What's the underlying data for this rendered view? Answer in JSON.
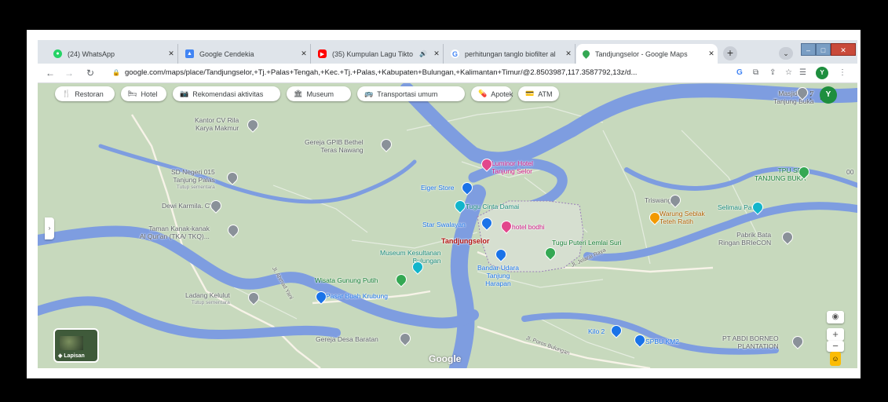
{
  "tabs": [
    {
      "title": "(24) WhatsApp",
      "favicon": "whatsapp-icon",
      "color": "#25d366"
    },
    {
      "title": "Google Cendekia",
      "favicon": "scholar-icon",
      "color": "#4285f4"
    },
    {
      "title": "(35) Kumpulan Lagu Tikto",
      "favicon": "youtube-icon",
      "color": "#ff0000"
    },
    {
      "title": "perhitungan tanglo biofilter al",
      "favicon": "google-icon",
      "color": "#4285f4"
    },
    {
      "title": "Tandjungselor - Google Maps",
      "favicon": "maps-icon",
      "color": "#34a853"
    }
  ],
  "address_bar": {
    "url": "google.com/maps/place/Tandjungselor,+Tj.+Palas+Tengah,+Kec.+Tj.+Palas,+Kabupaten+Bulungan,+Kalimantan+Timur/@2.8503987,117.3587792,13z/d..."
  },
  "profile_initial": "Y",
  "chips": [
    {
      "label": "Restoran",
      "icon": "restaurant-icon",
      "glyph": "🍴"
    },
    {
      "label": "Hotel",
      "icon": "hotel-icon",
      "glyph": "🛏"
    },
    {
      "label": "Rekomendasi aktivitas",
      "icon": "camera-icon",
      "glyph": "📷"
    },
    {
      "label": "Museum",
      "icon": "museum-icon",
      "glyph": "🏛"
    },
    {
      "label": "Transportasi umum",
      "icon": "bus-icon",
      "glyph": "🚌"
    },
    {
      "label": "Apotek",
      "icon": "pharmacy-icon",
      "glyph": "💊"
    },
    {
      "label": "ATM",
      "icon": "atm-icon",
      "glyph": "💳"
    }
  ],
  "places": [
    {
      "name": "Kantor CV Rila",
      "line2": "Karya Makmur",
      "kind": "grey"
    },
    {
      "name": "Gereja GPIB Bethel",
      "line2": "Teras Nawang",
      "kind": "grey"
    },
    {
      "name": "SD Negeri 015",
      "line2": "Tanjung Palas",
      "note": "Tutup sementara",
      "kind": "grey"
    },
    {
      "name": "Dewi Karmila. CV",
      "kind": "grey"
    },
    {
      "name": "Taman Kanak-kanak",
      "line2": "Al Qur'an (TKA/ TKQ)...",
      "kind": "grey"
    },
    {
      "name": "Luminor Hotel",
      "line2": "Tanjung Selor",
      "kind": "pink"
    },
    {
      "name": "Eiger Store",
      "kind": "blue"
    },
    {
      "name": "Tugu Cinta Damai",
      "kind": "teal"
    },
    {
      "name": "Star Swalayan",
      "kind": "blue"
    },
    {
      "name": "hotel bodhi",
      "kind": "pink"
    },
    {
      "name": "Tandjungselor",
      "kind": "red"
    },
    {
      "name": "Tugu Puteri Lemlai Suri",
      "kind": "green"
    },
    {
      "name": "Museum Kesultanan",
      "line2": "Bulungan",
      "kind": "teal"
    },
    {
      "name": "Bandar Udara",
      "line2": "Tanjung",
      "line3": "Harapan",
      "kind": "blue"
    },
    {
      "name": "Wisata Gunung Putih",
      "kind": "green"
    },
    {
      "name": "Pasar Buah Krubung",
      "kind": "blue"
    },
    {
      "name": "Ladang Kelulut",
      "note": "Tutup sementara",
      "kind": "grey"
    },
    {
      "name": "Triswangga",
      "kind": "grey"
    },
    {
      "name": "Masjid SP 7",
      "line2": "Tanjung Buka",
      "kind": "grey"
    },
    {
      "name": "TPU SP8",
      "line2": "TANJUNG BUKA",
      "kind": "green"
    },
    {
      "name": "Selimau Park",
      "kind": "teal"
    },
    {
      "name": "Warung Seblak",
      "line2": "Teteh Ratih",
      "kind": "orange"
    },
    {
      "name": "Pabrik Bata",
      "line2": "Ringan BRIeCON",
      "kind": "grey"
    },
    {
      "name": "Gereja Desa Baratan",
      "kind": "grey"
    },
    {
      "name": "Kilo 2",
      "kind": "blue"
    },
    {
      "name": "SPBU KM2",
      "kind": "blue"
    },
    {
      "name": "PT ABDI BORNEO",
      "line2": "PLANTATION",
      "kind": "grey"
    }
  ],
  "streets": [
    "Jl. Jelarai Raya",
    "Jl. Ahmad Yani",
    "Jl. Poros Bulungan"
  ],
  "layers_label": "Lapisan",
  "google_logo": "Google",
  "edge_label": "00"
}
